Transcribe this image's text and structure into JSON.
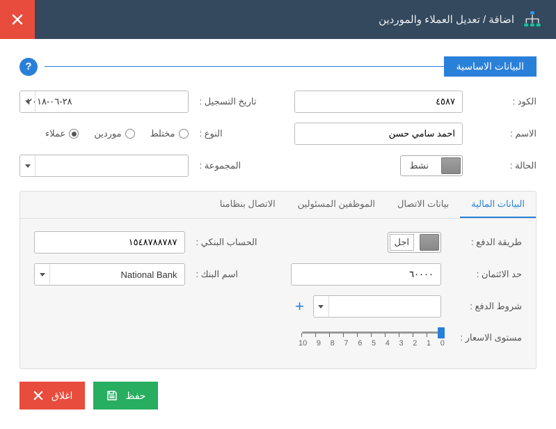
{
  "header": {
    "title": "اضافة / تعديل العملاء والموردين"
  },
  "section": {
    "basic_title": "البيانات الاساسية"
  },
  "labels": {
    "code": "الكود :",
    "reg_date": "تاريخ التسجيل :",
    "name": "الاسم :",
    "type": "النوع :",
    "status": "الحالة :",
    "group": "المجموعة :",
    "pay_method": "طريقة الدفع :",
    "bank_account": "الحساب البنكي :",
    "credit_limit": "حد الائتمان :",
    "bank_name": "اسم البنك :",
    "pay_terms": "شروط الدفع :",
    "price_level": "مستوى الاسعار :"
  },
  "values": {
    "code": "٤٥٨٧",
    "reg_date": "٢٨-٠٦-٢٠١٨",
    "name": "احمد سامي حسن",
    "status_text": "نشط",
    "pay_method_text": "اجل",
    "bank_account": "١٥٤٨٧٨٨٧٨٧",
    "credit_limit": "٦٠٠٠٠",
    "bank_name": "National Bank",
    "group": "",
    "pay_terms": ""
  },
  "radios": {
    "mixed": "مختلط",
    "suppliers": "موردين",
    "customers": "عملاء"
  },
  "tabs": {
    "financial": "البيانات المالية",
    "contact": "بيانات الاتصال",
    "staff": "الموظفين المسئولين",
    "system": "الاتصال بنظامنا"
  },
  "buttons": {
    "save": "حفظ",
    "close": "اغلاق"
  },
  "slider": {
    "labels": [
      "10",
      "9",
      "8",
      "7",
      "6",
      "5",
      "4",
      "3",
      "2",
      "1",
      "0"
    ]
  }
}
